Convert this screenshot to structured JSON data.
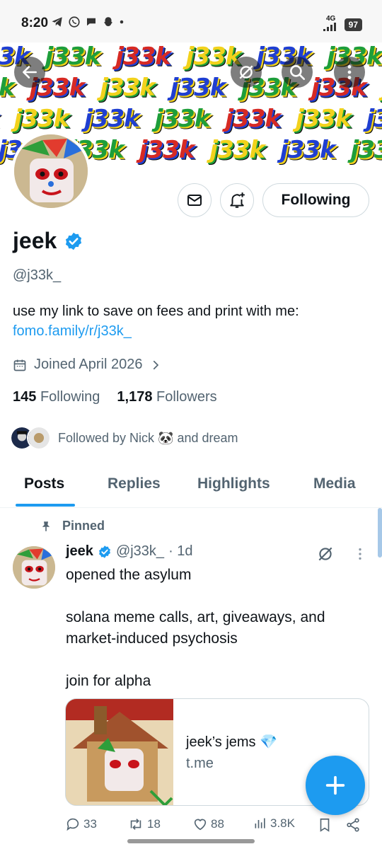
{
  "status_bar": {
    "time": "8:20",
    "network": "4G",
    "battery": "97"
  },
  "banner": {
    "text": "j33k"
  },
  "profile": {
    "name": "jeek",
    "handle": "@j33k_",
    "bio": "use my link to save on fees and print with me:",
    "bio_link": "fomo.family/r/j33k_",
    "joined": "Joined April 2026",
    "following_count": "145",
    "following_label": "Following",
    "followers_count": "1,178",
    "followers_label": "Followers",
    "followed_by": "Followed by Nick 🐼 and dream",
    "follow_button": "Following"
  },
  "tabs": [
    "Posts",
    "Replies",
    "Highlights",
    "Media"
  ],
  "post": {
    "pinned_label": "Pinned",
    "author": "jeek",
    "handle": "@j33k_",
    "time": "· 1d",
    "text": "opened the asylum\n\nsolana meme calls, art, giveaways, and market-induced psychosis\n\njoin for alpha",
    "card": {
      "title": "jeek’s jems 💎",
      "domain": "t.me"
    },
    "stats": {
      "replies": "33",
      "reposts": "18",
      "likes": "88",
      "views": "3.8K"
    }
  },
  "colors": {
    "accent": "#1d9bf0",
    "text": "#0f1419",
    "secondary": "#536471"
  }
}
